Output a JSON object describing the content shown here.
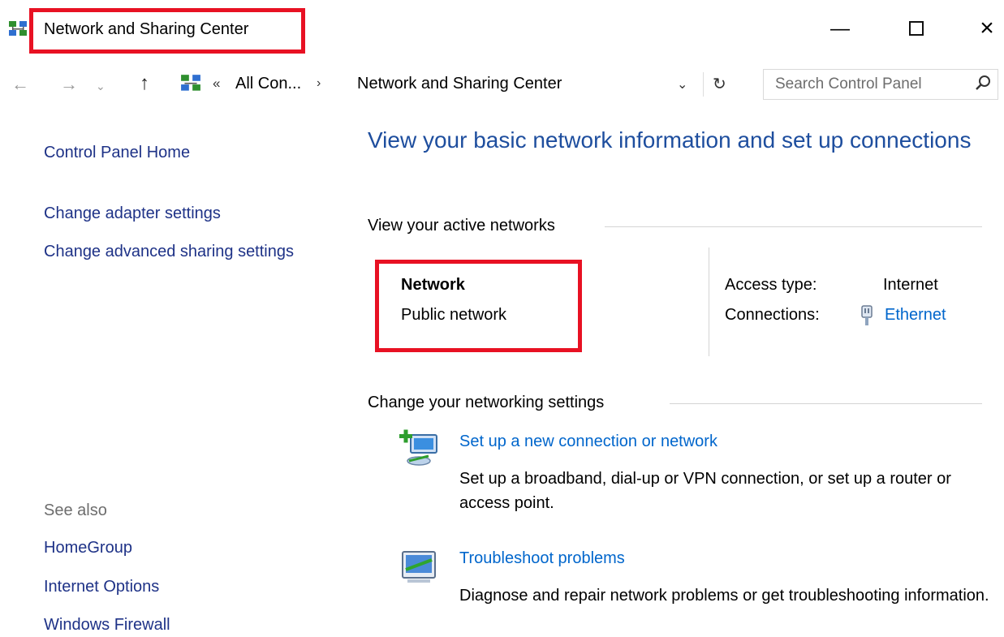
{
  "window": {
    "title": "Network and Sharing Center",
    "icon": "network-icon",
    "controls": {
      "minimize": "—",
      "maximize": "□",
      "close": "×"
    }
  },
  "nav": {
    "back": "←",
    "forward": "→",
    "recent": "⌄",
    "up": "↑",
    "address": {
      "overflow": "«",
      "segments": [
        "All Con...",
        "Network and Sharing Center"
      ],
      "separator": "›",
      "dropdown": "⌄",
      "refresh": "↻"
    },
    "search": {
      "placeholder": "Search Control Panel"
    }
  },
  "sidebar": {
    "items": [
      "Control Panel Home",
      "Change adapter settings",
      "Change advanced sharing settings"
    ],
    "see_also_label": "See also",
    "see_also": [
      "HomeGroup",
      "Internet Options",
      "Windows Firewall"
    ]
  },
  "main": {
    "heading": "View your basic network information and set up connections",
    "active_networks": {
      "title": "View your active networks",
      "network_name": "Network",
      "network_type": "Public network",
      "access_label": "Access type:",
      "access_value": "Internet",
      "connections_label": "Connections:",
      "connection_name": "Ethernet"
    },
    "settings": {
      "title": "Change your networking settings",
      "items": [
        {
          "title": "Set up a new connection or network",
          "description": "Set up a broadband, dial-up or VPN connection, or set up a router or access point."
        },
        {
          "title": "Troubleshoot problems",
          "description": "Diagnose and repair network problems or get troubleshooting information."
        }
      ]
    }
  },
  "colors": {
    "highlight": "#e81123",
    "link": "#0066cc",
    "heading": "#1e4e9e",
    "nav_link": "#1e3287"
  }
}
